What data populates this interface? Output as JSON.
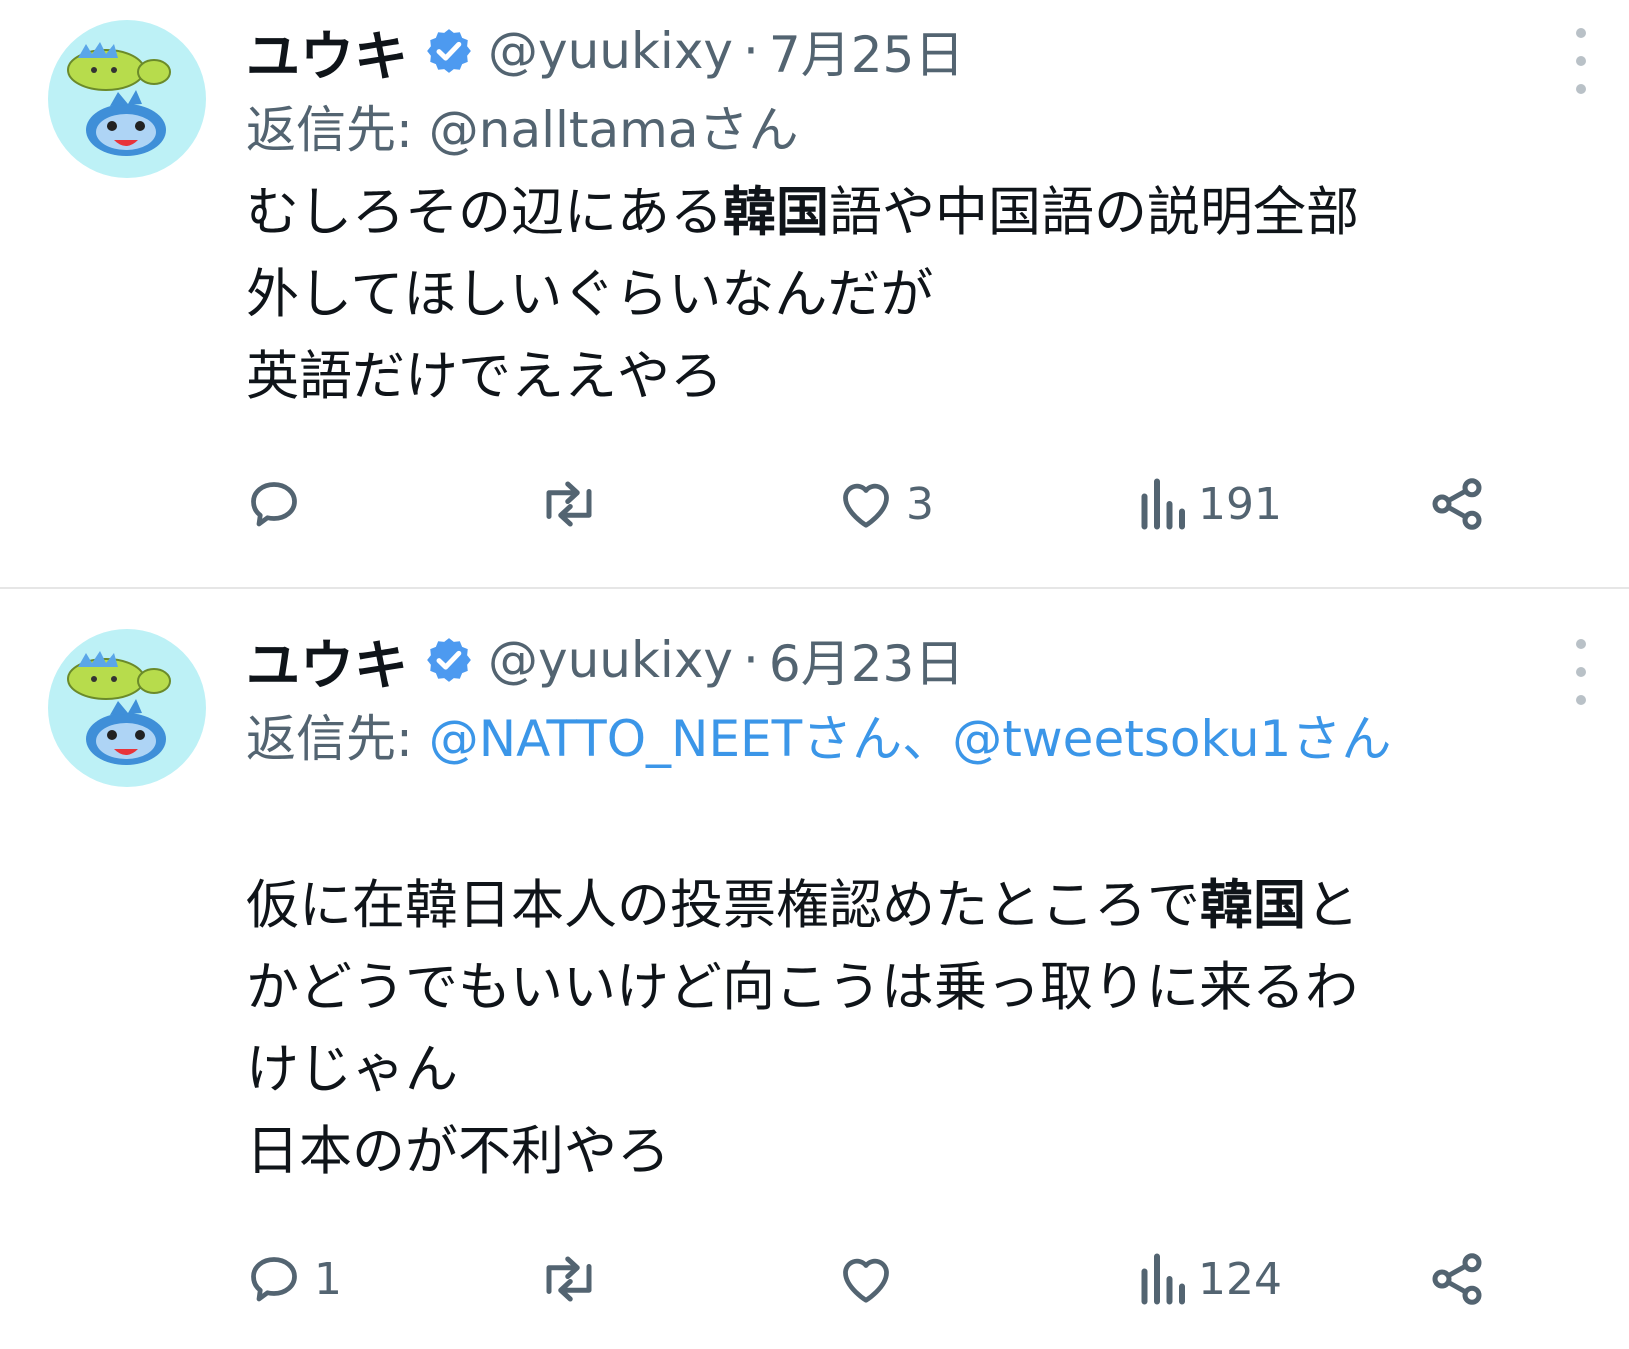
{
  "tweets": [
    {
      "name": "ユウキ",
      "handle": "@yuukixy",
      "separator": "·",
      "date": "7月25日",
      "reply_prefix": "返信先:",
      "reply_to": "@nalltamaさん",
      "reply_to_2": "",
      "body": [
        {
          "pre": "むしろその辺にある",
          "bold": "韓国",
          "post": "語や中国語の説明全部"
        },
        {
          "pre": "外してほしいぐらいなんだが",
          "bold": "",
          "post": ""
        },
        {
          "pre": "英語だけでええやろ",
          "bold": "",
          "post": ""
        }
      ],
      "replies": "",
      "reposts": "",
      "likes": "3",
      "views": "191"
    },
    {
      "name": "ユウキ",
      "handle": "@yuukixy",
      "separator": "·",
      "date": "6月23日",
      "reply_prefix": "返信先:",
      "reply_to": "@NATTO_NEETさん、",
      "reply_to_2": "@tweetsoku1さん",
      "body": [
        {
          "pre": "仮に在韓日本人の投票権認めたところで",
          "bold": "韓国",
          "post": "と"
        },
        {
          "pre": "かどうでもいいけど向こうは乗っ取りに来るわ",
          "bold": "",
          "post": ""
        },
        {
          "pre": "けじゃん",
          "bold": "",
          "post": ""
        },
        {
          "pre": "日本のが不利やろ",
          "bold": "",
          "post": ""
        }
      ],
      "replies": "1",
      "reposts": "",
      "likes": "",
      "views": "124"
    }
  ],
  "icons": [
    "verified-badge-icon",
    "more-icon",
    "reply-icon",
    "repost-icon",
    "like-icon",
    "views-icon",
    "share-icon"
  ],
  "colors": {
    "text": "#0f1419",
    "secondary": "#536471",
    "link": "#3b96e8",
    "verified": "#4d9af0",
    "divider": "#e6e6e6"
  }
}
